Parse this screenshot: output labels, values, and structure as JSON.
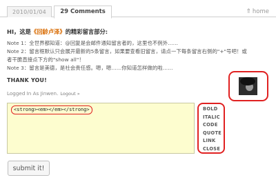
{
  "tabs": {
    "date": "2010/01/04",
    "comments": "29 Comments",
    "home": "home",
    "home_icon": "up-arrow-icon"
  },
  "intro": {
    "prefix": "HI，这是",
    "highlight": "《回龄卢泽》",
    "suffix": "的精彩留言部分:"
  },
  "notes": [
    "Note 1：全世界都知道：@回复是会邮件通知留言者的，这里也不例外……",
    "Note 2：留言框默认只会展开最新的5条留言，如果要查看旧留言，请点一下每条留言右侧的\"+\"号吧！或",
    "者干脆直接点下方的\"show all\"！",
    "Note 3：留言是美德，是社会责任感。嗯，嗯……你知道怎样做的啦……"
  ],
  "thanks": "THANK YOU!",
  "login": {
    "text": "Logged In As Jinwen.",
    "logout": "Logout »"
  },
  "comment": {
    "value": "<strong><em></em></strong>"
  },
  "toolbar": [
    "BOLD",
    "ITALIC",
    "CODE",
    "QUOTE",
    "LINK",
    "CLOSE"
  ],
  "submit_label": "submit it!",
  "colors": {
    "accent_red": "#e02020",
    "highlight_orange": "#d86a00",
    "textarea_bg": "#fdfdcf"
  }
}
